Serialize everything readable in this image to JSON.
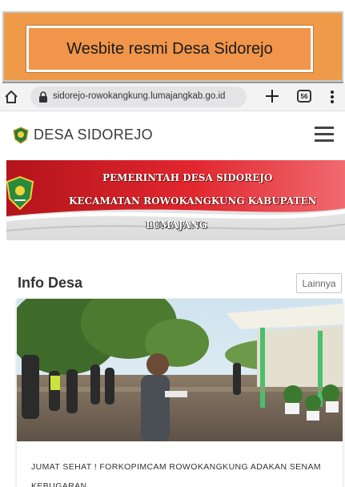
{
  "caption": {
    "text": "Wesbite resmi Desa Sidorejo",
    "background_color": "#ef9a48"
  },
  "browser": {
    "url": "sidorejo-rowokangkung.lumajangkab.go.id",
    "tab_count": "56",
    "icons": [
      "home-icon",
      "lock-icon",
      "plus-icon",
      "tabs-icon",
      "kebab-menu-icon"
    ]
  },
  "site_header": {
    "title": "DESA SIDOREJO",
    "icons": [
      "village-emblem-icon",
      "hamburger-menu-icon"
    ]
  },
  "banner": {
    "line1": "PEMERINTAH DESA SIDOREJO",
    "line2": "KECAMATAN ROWOKANGKUNG KABUPATEN",
    "line3": "LUMAJANG",
    "accent_color": "#d8262c"
  },
  "info_section": {
    "title": "Info Desa",
    "more_label": "Lainnya"
  },
  "article": {
    "title": "JUMAT SEHAT ! FORKOPIMCAM ROWOKANGKUNG ADAKAN SENAM KEBUGARAN"
  }
}
